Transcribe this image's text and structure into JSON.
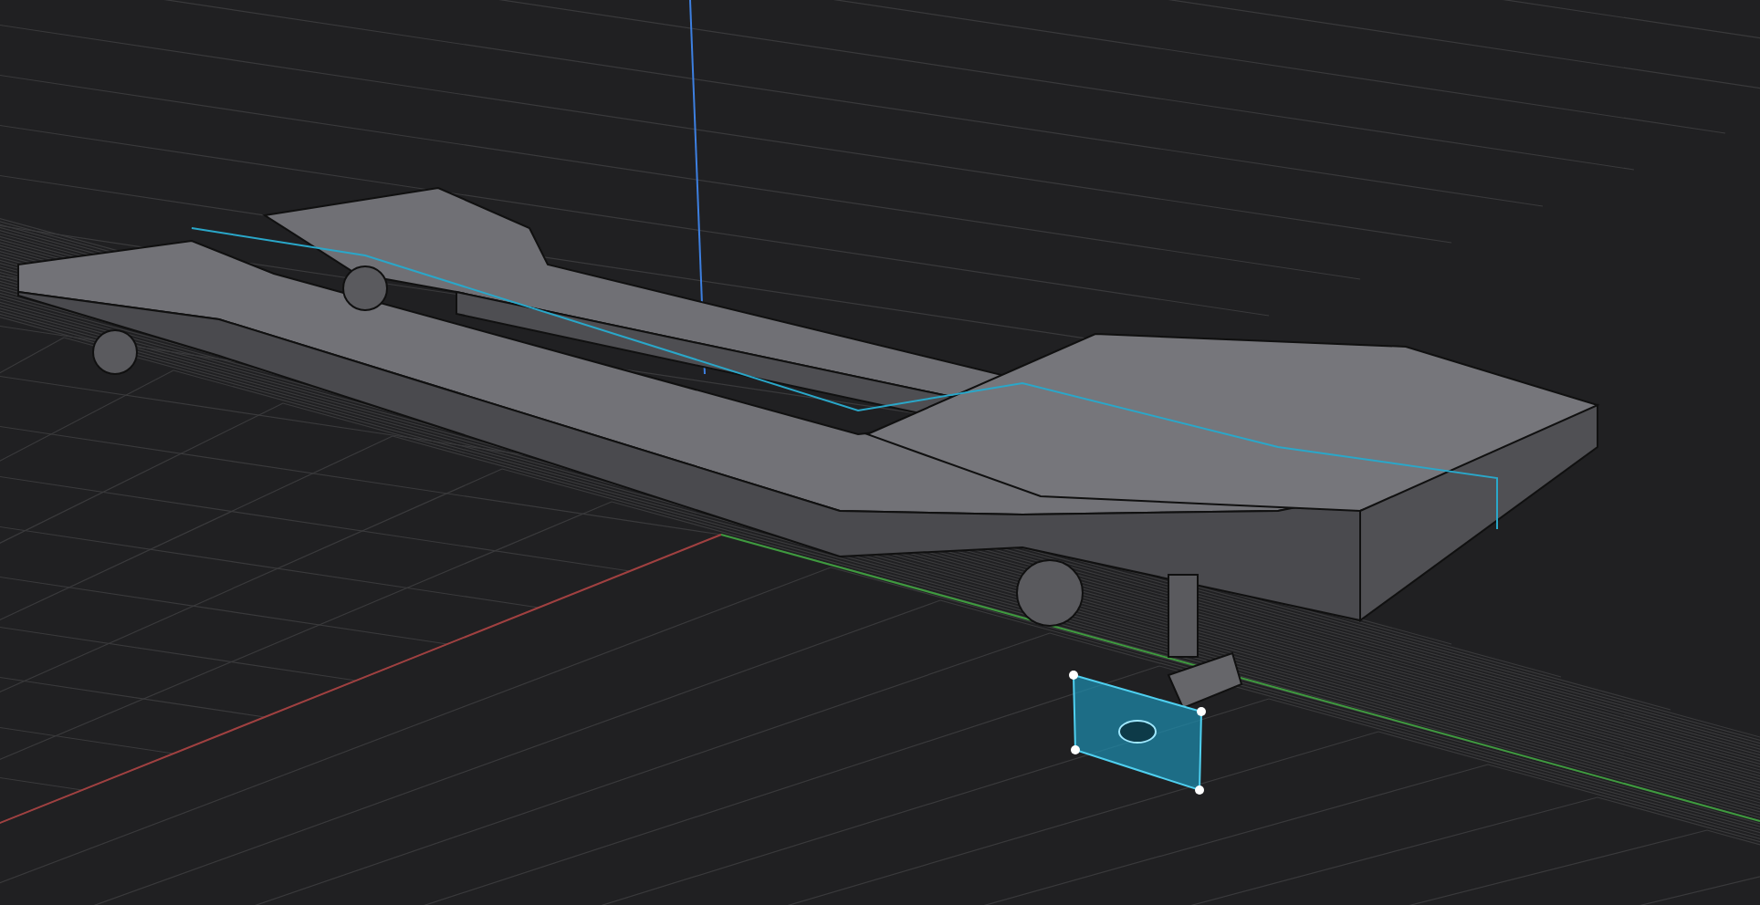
{
  "viewport": {
    "grid_visible": true,
    "axes_visible": true,
    "face_selected": true
  }
}
